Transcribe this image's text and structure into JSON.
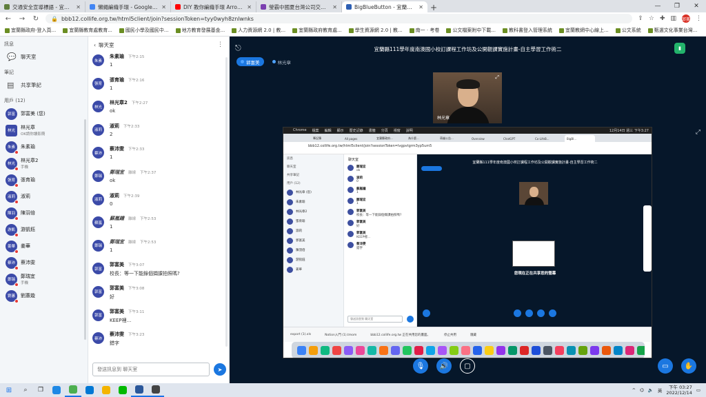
{
  "browser": {
    "tabs": [
      {
        "title": "交通安全宣導標語 - 宜蘭車區 - ...",
        "color": "#5f7e3c"
      },
      {
        "title": "懶繩編織手環 - Google 搜尋",
        "color": "#4285f4"
      },
      {
        "title": "DIY 教你編織手環 Arrow Braid",
        "color": "#ff0000"
      },
      {
        "title": "瑩霸中國夏台灣公司交配方 - 成...",
        "color": "#7b3fb0"
      },
      {
        "title": "BigBlueButton - 宜蘭縣111...",
        "color": "#2d5fb3",
        "active": true
      }
    ],
    "url": "bbb12.collife.org.tw/html5client/join?sessionToken=tyy0wyh8znlwnks",
    "profile_initial": "邱美",
    "window_controls": [
      "—",
      "❐",
      "✕"
    ],
    "bookmarks": [
      "宜蘭縣政府-登入頁...",
      "宜蘭縣教育處教育...",
      "國民小學及國民中...",
      "地方教育發展基金...",
      "人力資源網 2.0 | 教...",
      "宜蘭縣政府教育處...",
      "學生資源網 2.0 | 教...",
      "南一 · 考卷",
      "公文檔案附中下載...",
      "教科書登入管理系統",
      "宜蘭教網中心線上...",
      "公文系統",
      "甄選文化事業台灣..."
    ]
  },
  "users_panel": {
    "messages_label": "訊息",
    "public_chat": "聊天室",
    "notes_label": "筆記",
    "shared_notes": "共享筆記",
    "users_label": "用戶 (12)",
    "users": [
      {
        "initials": "郭富",
        "name": "郭富美 (您)",
        "sub": "",
        "color": "#3b4aa8",
        "square": false
      },
      {
        "initials": "林光",
        "name": "林光章",
        "sub": "OK請你讀影簡",
        "color": "#3b4aa8",
        "square": true
      },
      {
        "initials": "朱素",
        "name": "朱素瑜",
        "sub": "",
        "color": "#3b4aa8",
        "square": false
      },
      {
        "initials": "林光",
        "name": "林光章2",
        "sub": "手機",
        "color": "#3b4aa8",
        "square": false
      },
      {
        "initials": "張育",
        "name": "張育瑜",
        "sub": "",
        "color": "#3b4aa8",
        "square": false
      },
      {
        "initials": "淑莉",
        "name": "淑莉",
        "sub": "",
        "color": "#3b4aa8",
        "square": false
      },
      {
        "initials": "陳羽",
        "name": "陳羽倍",
        "sub": "",
        "color": "#3b4aa8",
        "square": false
      },
      {
        "initials": "游凱",
        "name": "游凱鈺",
        "sub": "",
        "color": "#3b4aa8",
        "square": false
      },
      {
        "initials": "姜華",
        "name": "姜華",
        "sub": "",
        "color": "#3b4aa8",
        "square": false
      },
      {
        "initials": "蔡沛",
        "name": "蔡沛雯",
        "sub": "",
        "color": "#3b4aa8",
        "square": false
      },
      {
        "initials": "鄭瑞",
        "name": "鄭瑞宜",
        "sub": "手機",
        "color": "#3b4aa8",
        "square": false
      },
      {
        "initials": "劉蕙",
        "name": "劉蕙嫙",
        "sub": "",
        "color": "#3b4aa8",
        "square": false
      }
    ]
  },
  "chat": {
    "header": "聊天室",
    "input_placeholder": "發送訊息到 聊天室",
    "messages": [
      {
        "initials": "朱素",
        "name": "朱素瑜",
        "tag": "",
        "time": "下午2:15",
        "text": "1",
        "offline": false
      },
      {
        "initials": "張育",
        "name": "張育瑜",
        "tag": "",
        "time": "下午2:16",
        "text": "1",
        "offline": false
      },
      {
        "initials": "林光",
        "name": "林光章2",
        "tag": "",
        "time": "下午2:27",
        "text": "ok",
        "offline": false
      },
      {
        "initials": "淑莉",
        "name": "淑莉",
        "tag": "",
        "time": "下午2:33",
        "text": "2",
        "offline": false
      },
      {
        "initials": "蔡沛",
        "name": "蔡沛雯",
        "tag": "",
        "time": "下午2:33",
        "text": "1",
        "offline": false
      },
      {
        "initials": "鄭瑞",
        "name": "鄭瑞宜",
        "tag": "離線",
        "time": "下午2:37",
        "text": "ok",
        "offline": true
      },
      {
        "initials": "淑莉",
        "name": "淑莉",
        "tag": "",
        "time": "下午2:39",
        "text": "0",
        "offline": false
      },
      {
        "initials": "蘇嵐",
        "name": "蘇嵐鐘",
        "tag": "離線",
        "time": "下午2:53",
        "text": "1",
        "offline": true
      },
      {
        "initials": "鄭瑞",
        "name": "鄭瑞宜",
        "tag": "離線",
        "time": "下午2:53",
        "text": "1",
        "offline": true
      },
      {
        "initials": "郭富",
        "name": "郭富美",
        "tag": "",
        "time": "下午3:07",
        "text": "校長：等一下能錄個擷課拍照嗎?",
        "offline": false
      },
      {
        "initials": "郭富",
        "name": "郭富美",
        "tag": "",
        "time": "下午3:08",
        "text": "好",
        "offline": false
      },
      {
        "initials": "郭富",
        "name": "郭富美",
        "tag": "",
        "time": "下午3:11",
        "text": "KEEP裡...",
        "offline": false
      },
      {
        "initials": "蔡沛",
        "name": "蔡沛雯",
        "tag": "",
        "time": "下午3:23",
        "text": "錯字",
        "offline": false
      }
    ]
  },
  "presentation": {
    "title": "宜蘭縣111學年度南澳國小校訂課程工作坊及公開觀課實施計畫-自主學習工作術二",
    "talkers": [
      "郭富美",
      "林光章"
    ],
    "webcam_name": "林光章",
    "screenshare": {
      "mac_menu": [
        "Chrome",
        "檔案",
        "編輯",
        "顯示",
        "歷史記錄",
        "書籤",
        "分頁",
        "視窗",
        "說明"
      ],
      "mac_clock": "12月14日 週三 下午3:27",
      "tabs": [
        "筆記簿",
        "All pages",
        "宜蘭縣政府...",
        "為什麼...",
        "萌貓公告...",
        "Overview",
        "ChatGPT",
        "Co-LifeB...",
        "BigBl..."
      ],
      "url": "bbb12.collife.org.tw/html5client/join?sessionToken=lvgpvtgrm3yp5um5",
      "users": [
        "林光章 (您)",
        "朱素瑜",
        "林光章2",
        "張育瑜",
        "淑莉",
        "郭富美",
        "陳羽倍",
        "游凱鈺",
        "姜華"
      ],
      "chat": [
        {
          "name": "鄭瑞宜",
          "text": "ok"
        },
        {
          "name": "淑莉",
          "text": "0"
        },
        {
          "name": "蘇嵐鐘",
          "text": "1"
        },
        {
          "name": "鄭瑞宜",
          "text": "1"
        },
        {
          "name": "郭富美",
          "text": "校長：等一下能錄個擷課拍照嗎?"
        },
        {
          "name": "郭富美",
          "text": "好"
        },
        {
          "name": "郭富美",
          "text": "KEEP裡..."
        },
        {
          "name": "蔡沛雯",
          "text": "錯字"
        }
      ],
      "chat_placeholder": "發送訊息到 聊天室",
      "sharing_msg": "您現在正在共享您的螢幕",
      "downloads": [
        "export (1).xls",
        "Notion入門 (1).tmom",
        "bbb12.collife.org.tw 正在共用您的畫面。",
        "停止共用",
        "隱藏"
      ],
      "dock_colors": [
        "#3b82f6",
        "#f59e0b",
        "#10b981",
        "#ef4444",
        "#8b5cf6",
        "#ec4899",
        "#14b8a6",
        "#f97316",
        "#6366f1",
        "#22c55e",
        "#e11d48",
        "#0ea5e9",
        "#a855f7",
        "#84cc16",
        "#fb7185",
        "#2563eb",
        "#facc15",
        "#9333ea",
        "#059669",
        "#dc2626",
        "#1d4ed8",
        "#4b5563",
        "#f43f5e",
        "#0891b2",
        "#65a30d",
        "#7c3aed",
        "#ea580c",
        "#0284c7",
        "#db2777",
        "#16a34a"
      ]
    }
  },
  "taskbar": {
    "time": "下午 03:27",
    "date": "2022/12/14",
    "ime": "英",
    "apps": [
      {
        "color": "#1e88e5",
        "open": false
      },
      {
        "color": "#4caf50",
        "open": true
      },
      {
        "color": "#0078d4",
        "open": false
      },
      {
        "color": "#f4b400",
        "open": false
      },
      {
        "color": "#00b900",
        "open": false
      },
      {
        "color": "#2b579a",
        "open": true
      },
      {
        "color": "#444444",
        "open": true
      }
    ]
  }
}
